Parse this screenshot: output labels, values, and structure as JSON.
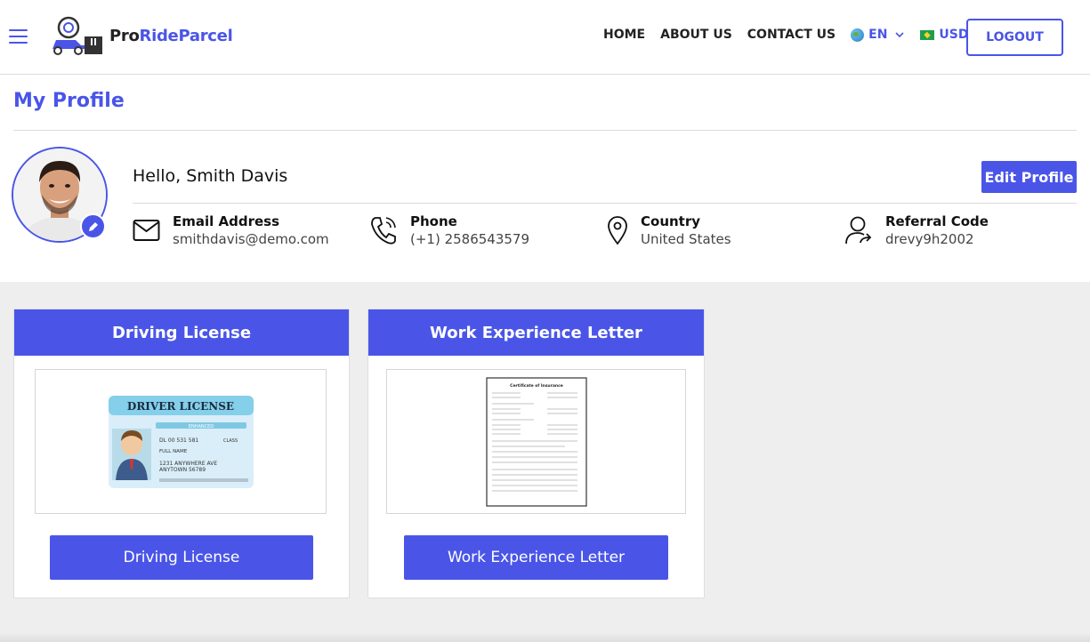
{
  "header": {
    "brand_pro": "Pro",
    "brand_rest": "RideParcel",
    "nav": [
      "HOME",
      "ABOUT US",
      "CONTACT US"
    ],
    "language": "EN",
    "currency": "USD",
    "logout_label": "LOGOUT"
  },
  "profile": {
    "page_title": "My Profile",
    "greeting": "Hello, Smith Davis",
    "edit_label": "Edit Profile",
    "email_label": "Email Address",
    "email_value": "smithdavis@demo.com",
    "phone_label": "Phone",
    "phone_value": "(+1) 2586543579",
    "country_label": "Country",
    "country_value": "United States",
    "referral_label": "Referral Code",
    "referral_value": "drevy9h2002"
  },
  "documents": [
    {
      "title": "Driving License",
      "button_label": "Driving License",
      "image": {
        "heading": "DRIVER LICENSE",
        "badge": "ENHANCED",
        "line1": "DL 00 531 581",
        "class_label": "CLASS",
        "name_label": "FULL NAME",
        "addr1": "1231 ANYWHERE AVE",
        "addr2": "ANYTOWN 56789"
      }
    },
    {
      "title": "Work Experience Letter",
      "button_label": "Work Experience Letter",
      "image": {
        "heading": "Certificate of Insurance"
      }
    }
  ],
  "colors": {
    "accent": "#4a55e8",
    "grey_bg": "#eeeeee"
  }
}
